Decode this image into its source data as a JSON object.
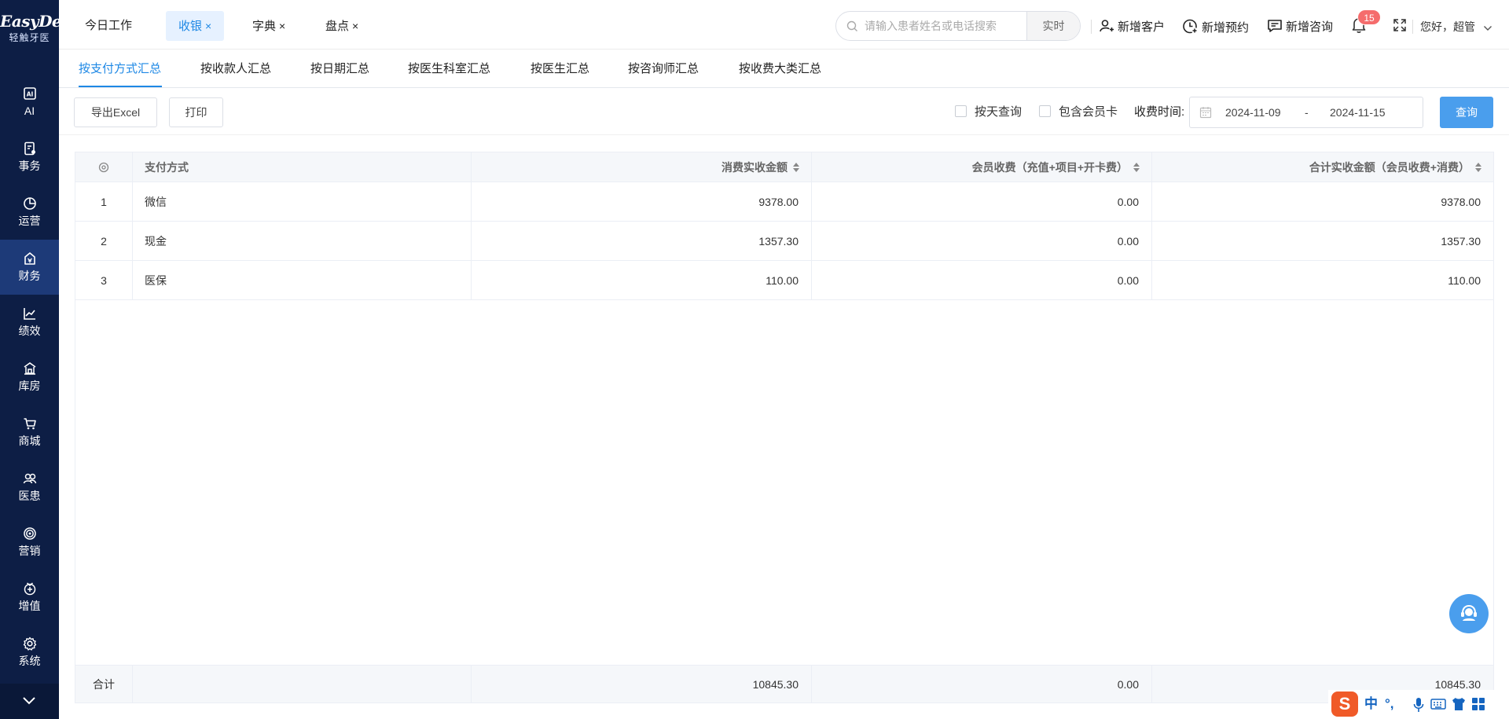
{
  "brand": {
    "name": "EasyDent",
    "sub": "轻触牙医"
  },
  "sidebar": {
    "items": [
      {
        "label": "AI",
        "icon": "ai-icon"
      },
      {
        "label": "事务",
        "icon": "clipboard-icon"
      },
      {
        "label": "运营",
        "icon": "pie-chart-icon"
      },
      {
        "label": "财务",
        "icon": "finance-icon"
      },
      {
        "label": "绩效",
        "icon": "line-chart-icon"
      },
      {
        "label": "库房",
        "icon": "warehouse-icon"
      },
      {
        "label": "商城",
        "icon": "cart-icon"
      },
      {
        "label": "医患",
        "icon": "people-icon"
      },
      {
        "label": "营销",
        "icon": "target-icon"
      },
      {
        "label": "增值",
        "icon": "value-icon"
      },
      {
        "label": "系统",
        "icon": "gear-icon"
      }
    ],
    "active_index": 3
  },
  "header": {
    "tabs": [
      {
        "label": "今日工作",
        "closable": false
      },
      {
        "label": "收银",
        "closable": true,
        "active": true
      },
      {
        "label": "字典",
        "closable": true
      },
      {
        "label": "盘点",
        "closable": true
      }
    ],
    "close_glyph": "×",
    "search": {
      "placeholder": "请输入患者姓名或电话搜索",
      "button": "实时"
    },
    "actions": {
      "new_customer": "新增客户",
      "new_appointment": "新增预约",
      "new_consult": "新增咨询"
    },
    "notification_count": "15",
    "greeting": "您好，超管"
  },
  "subtabs": [
    "按支付方式汇总",
    "按收款人汇总",
    "按日期汇总",
    "按医生科室汇总",
    "按医生汇总",
    "按咨询师汇总",
    "按收费大类汇总"
  ],
  "toolbar": {
    "export": "导出Excel",
    "print": "打印",
    "by_day": "按天查询",
    "include_member_card": "包含会员卡",
    "time_label": "收费时间:",
    "date_start": "2024-11-09",
    "date_sep": "-",
    "date_end": "2024-11-15",
    "query": "查询"
  },
  "table": {
    "headers": [
      "支付方式",
      "消费实收金额",
      "会员收费（充值+项目+开卡费）",
      "合计实收金额（会员收费+消费）"
    ],
    "rows": [
      {
        "index": "1",
        "method": "微信",
        "consume": "9378.00",
        "member": "0.00",
        "total": "9378.00"
      },
      {
        "index": "2",
        "method": "现金",
        "consume": "1357.30",
        "member": "0.00",
        "total": "1357.30"
      },
      {
        "index": "3",
        "method": "医保",
        "consume": "110.00",
        "member": "0.00",
        "total": "110.00"
      }
    ],
    "footer": {
      "label": "合计",
      "consume": "10845.30",
      "member": "0.00",
      "total": "10845.30"
    }
  },
  "ime": {
    "logo": "S",
    "lang": "中",
    "punct": "°,"
  }
}
